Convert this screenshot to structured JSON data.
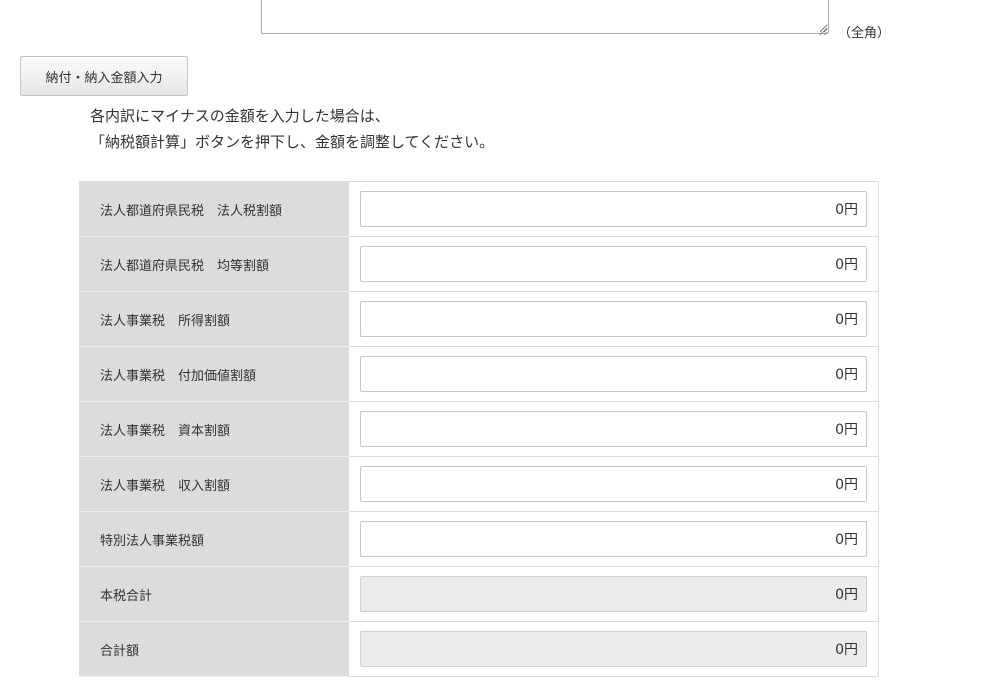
{
  "memo": {
    "value": "",
    "fullwidth_note": "（全角）"
  },
  "payment_button": {
    "label": "納付・納入金額入力"
  },
  "notice": {
    "line1": "各内訳にマイナスの金額を入力した場合は、",
    "line2": "「納税額計算」ボタンを押下し、金額を調整してください。"
  },
  "rows": [
    {
      "label": "法人都道府県民税　法人税割額",
      "value": "0円",
      "readonly": false
    },
    {
      "label": "法人都道府県民税　均等割額",
      "value": "0円",
      "readonly": false
    },
    {
      "label": "法人事業税　所得割額",
      "value": "0円",
      "readonly": false
    },
    {
      "label": "法人事業税　付加価値割額",
      "value": "0円",
      "readonly": false
    },
    {
      "label": "法人事業税　資本割額",
      "value": "0円",
      "readonly": false
    },
    {
      "label": "法人事業税　収入割額",
      "value": "0円",
      "readonly": false
    },
    {
      "label": "特別法人事業税額",
      "value": "0円",
      "readonly": false
    },
    {
      "label": "本税合計",
      "value": "0円",
      "readonly": true
    },
    {
      "label": "合計額",
      "value": "0円",
      "readonly": true
    }
  ]
}
